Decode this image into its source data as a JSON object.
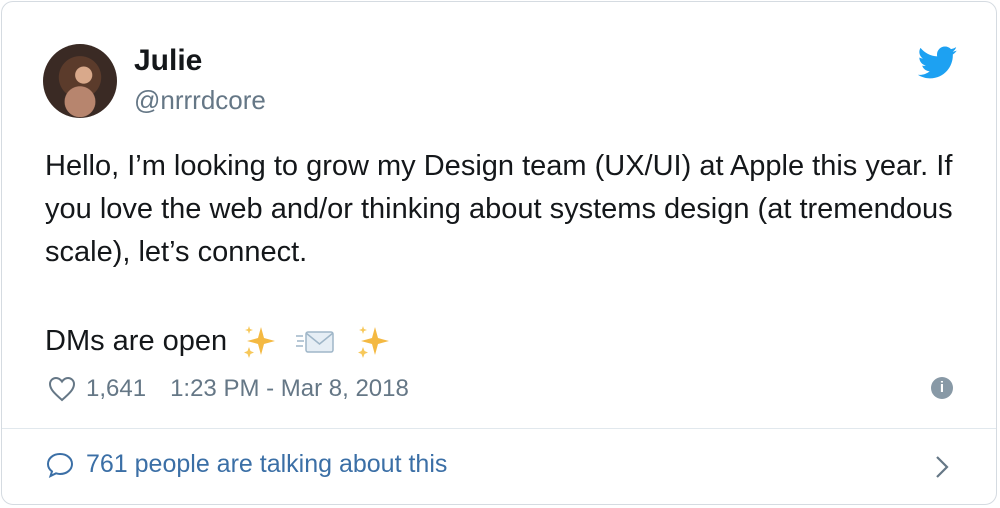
{
  "user": {
    "name": "Julie",
    "handle": "@nrrrdcore"
  },
  "tweet": {
    "paragraph1": "Hello, I’m looking to grow my Design team (UX/UI) at Apple this year. If you love the web and/or thinking about systems design (at tremendous scale), let’s connect.",
    "paragraph2": "DMs are open",
    "emoji": [
      "sparkles-icon",
      "envelope-icon",
      "sparkles-icon"
    ]
  },
  "meta": {
    "likes": "1,641",
    "timestamp": "1:23 PM - Mar 8, 2018"
  },
  "footer": {
    "talking": "761 people are talking about this"
  },
  "colors": {
    "twitter_blue": "#1da1f2",
    "link_blue": "#3b6fa6",
    "text": "#14171a",
    "muted": "#657786"
  }
}
